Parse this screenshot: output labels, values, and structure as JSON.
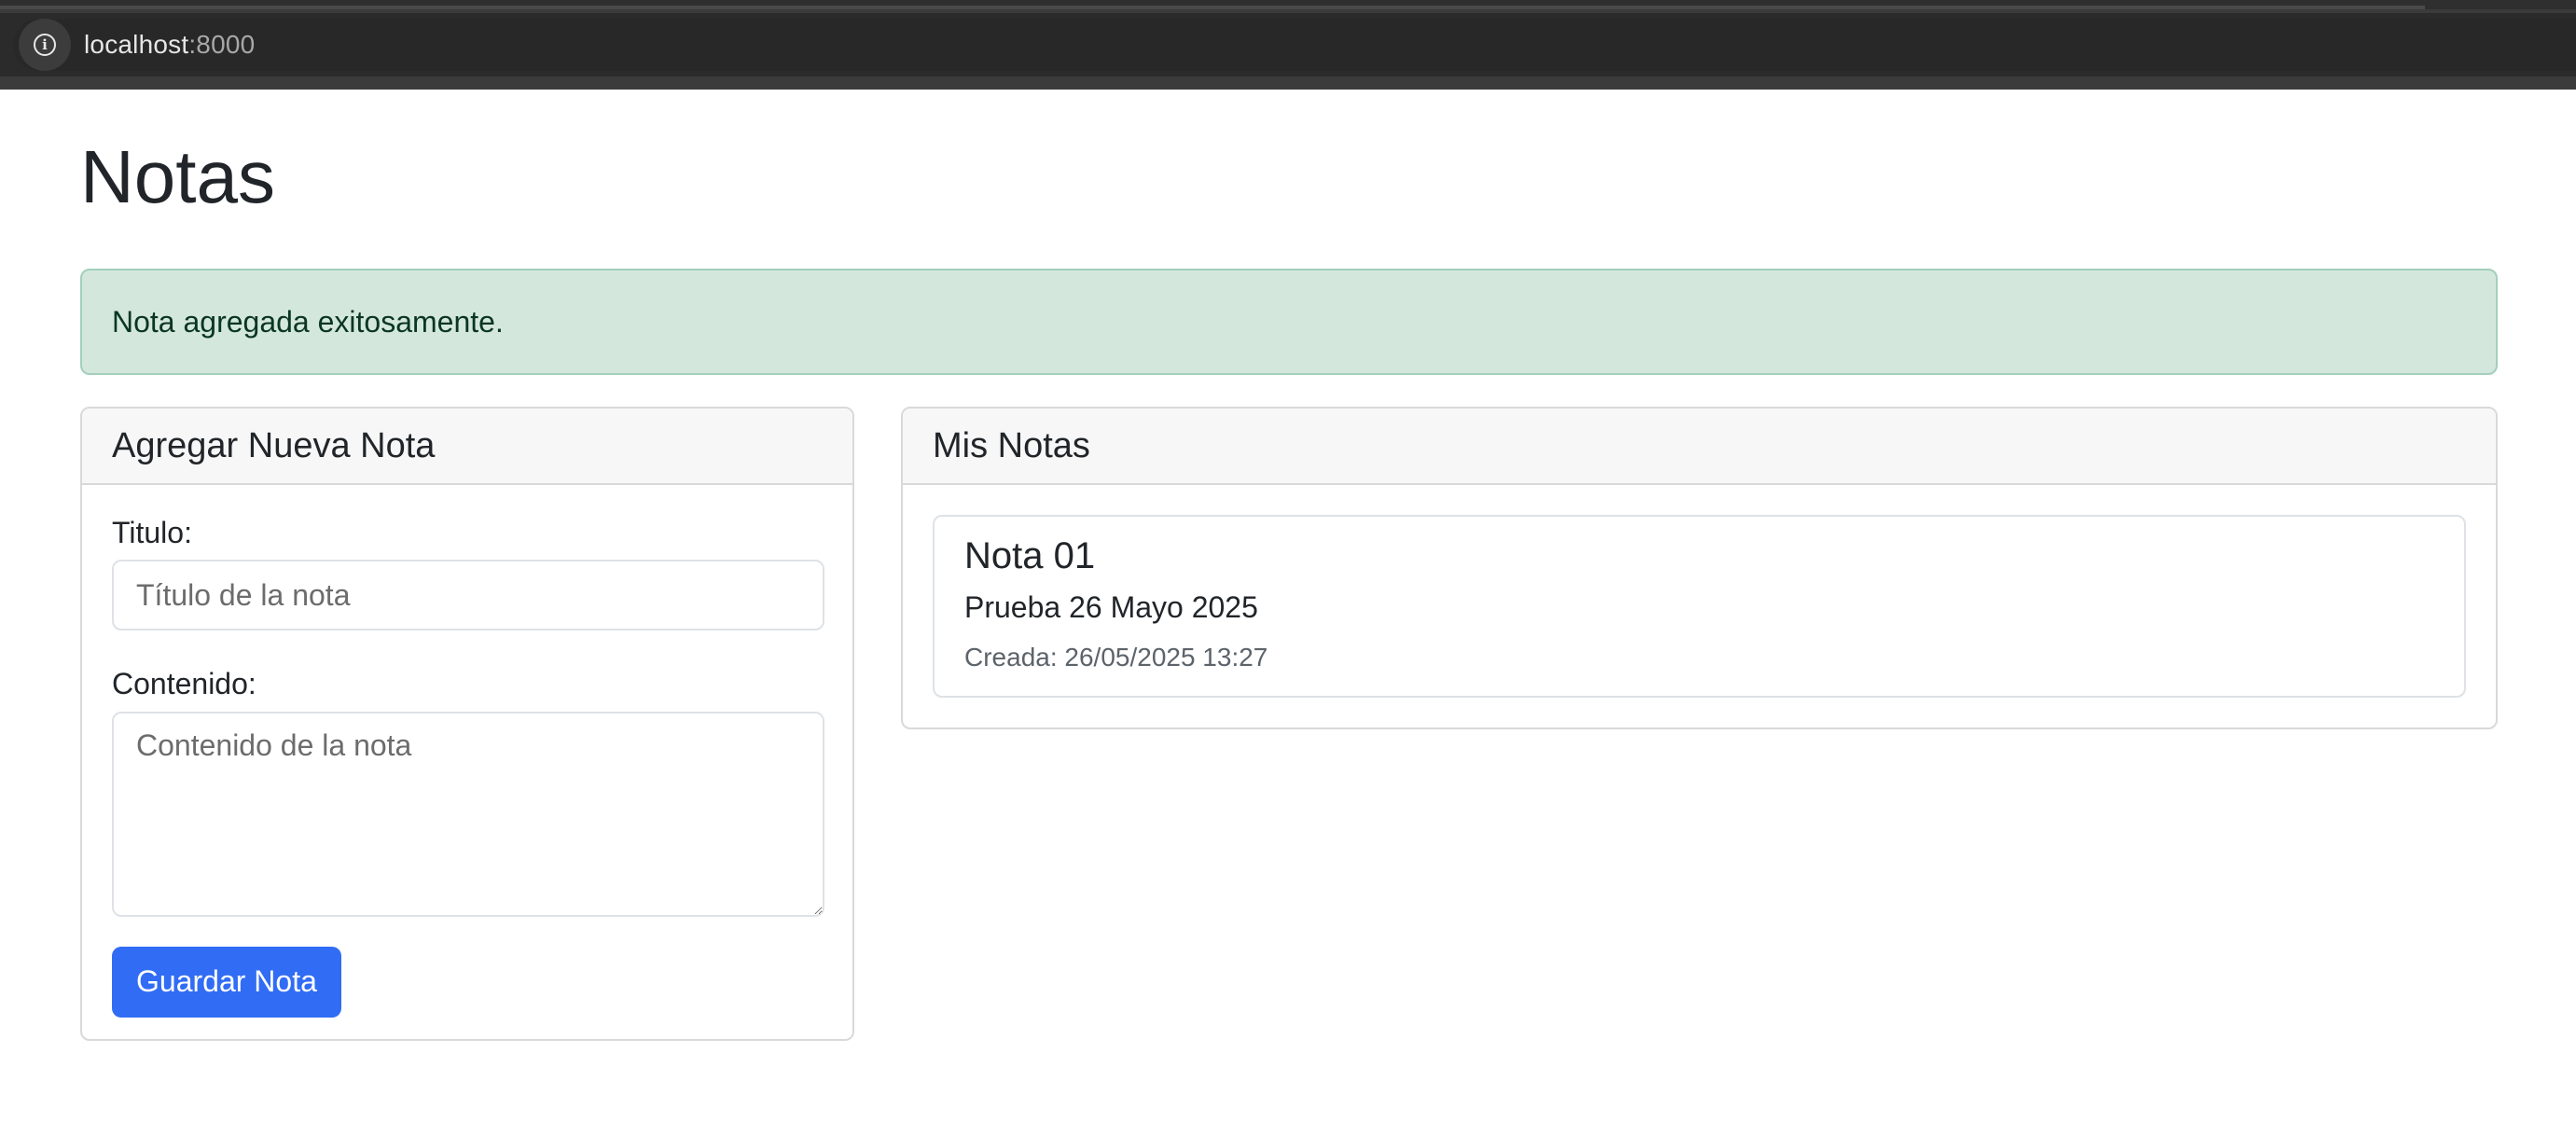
{
  "browser": {
    "url_host": "localhost",
    "url_port": ":8000"
  },
  "page": {
    "title": "Notas"
  },
  "alert": {
    "message": "Nota agregada exitosamente."
  },
  "form_card": {
    "header": "Agregar Nueva Nota",
    "title_label": "Titulo:",
    "title_placeholder": "Título de la nota",
    "title_value": "",
    "content_label": "Contenido:",
    "content_placeholder": "Contenido de la nota",
    "content_value": "",
    "save_label": "Guardar Nota"
  },
  "notes_card": {
    "header": "Mis Notas",
    "notes": [
      {
        "title": "Nota 01",
        "content": "Prueba 26 Mayo 2025",
        "created": "Creada: 26/05/2025 13:27"
      }
    ]
  },
  "colors": {
    "primary": "#316cf4",
    "alert_success_bg": "#d4e7dd",
    "alert_success_border": "#a3cfbb",
    "alert_success_text": "#0a3622",
    "browser_chrome": "#282828"
  },
  "icons": {
    "address_bar": "info-icon"
  }
}
